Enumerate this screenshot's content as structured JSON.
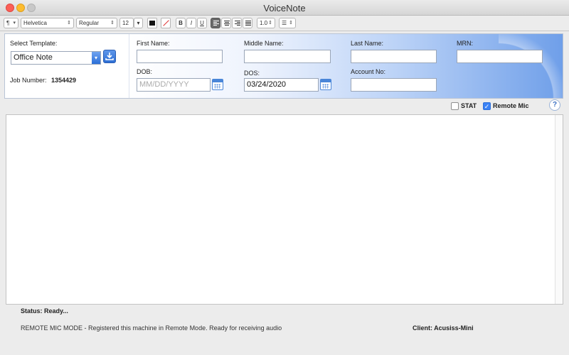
{
  "window": {
    "title": "VoiceNote"
  },
  "toolbar": {
    "paragraph": "¶",
    "font_family": "Helvetica",
    "font_style": "Regular",
    "font_size": "12",
    "bold": "B",
    "italic": "I",
    "underline": "U",
    "line_spacing": "1.0",
    "text_color": "#111111"
  },
  "form": {
    "template": {
      "label": "Select Template:",
      "value": "Office Note"
    },
    "job": {
      "label": "Job Number:",
      "value": "1354429"
    },
    "first_name": {
      "label": "First Name:",
      "value": ""
    },
    "middle_name": {
      "label": "Middle Name:",
      "value": ""
    },
    "last_name": {
      "label": "Last Name:",
      "value": ""
    },
    "mrn": {
      "label": "MRN:",
      "value": ""
    },
    "dob": {
      "label": "DOB:",
      "value": "",
      "placeholder": "MM/DD/YYYY"
    },
    "dos": {
      "label": "DOS:",
      "value": "03/24/2020"
    },
    "account": {
      "label": "Account No:",
      "value": ""
    }
  },
  "options": {
    "stat": {
      "label": "STAT",
      "checked": false
    },
    "remote_mic": {
      "label": "Remote Mic",
      "checked": true
    },
    "help": "?"
  },
  "status": {
    "label": "Status: Ready...",
    "message": "REMOTE MIC MODE - Registered this machine in Remote Mode. Ready for receiving audio",
    "client": "Client: Acusiss-Mini"
  },
  "colors": {
    "header_gradient_end": "#6f9fe9",
    "accent": "#3a82f6"
  }
}
